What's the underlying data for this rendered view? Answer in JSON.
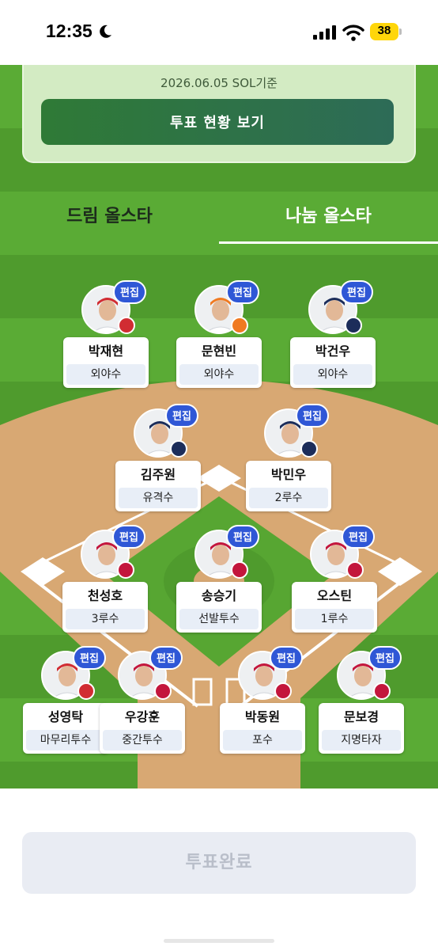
{
  "status_bar": {
    "time": "12:35",
    "battery": "38"
  },
  "info": {
    "date_text": "2026.06.05 SOL기준",
    "vote_status_button": "투표 현황 보기"
  },
  "tabs": [
    {
      "label": "드림 올스타",
      "active": false
    },
    {
      "label": "나눔 올스타",
      "active": true
    }
  ],
  "edit_label": "편집",
  "players": [
    {
      "name": "박재현",
      "position": "외야수",
      "team_color": "#d12c32"
    },
    {
      "name": "문현빈",
      "position": "외야수",
      "team_color": "#f07a21"
    },
    {
      "name": "박건우",
      "position": "외야수",
      "team_color": "#1c2d5a"
    },
    {
      "name": "김주원",
      "position": "유격수",
      "team_color": "#1c2d5a"
    },
    {
      "name": "박민우",
      "position": "2루수",
      "team_color": "#1c2d5a"
    },
    {
      "name": "천성호",
      "position": "3루수",
      "team_color": "#c3163c"
    },
    {
      "name": "송승기",
      "position": "선발투수",
      "team_color": "#c3163c"
    },
    {
      "name": "오스틴",
      "position": "1루수",
      "team_color": "#c3163c"
    },
    {
      "name": "성영탁",
      "position": "마무리투수",
      "team_color": "#d12c32"
    },
    {
      "name": "우강훈",
      "position": "중간투수",
      "team_color": "#c3163c"
    },
    {
      "name": "박동원",
      "position": "포수",
      "team_color": "#c3163c"
    },
    {
      "name": "문보경",
      "position": "지명타자",
      "team_color": "#c3163c"
    }
  ],
  "vote_complete_button": "투표완료",
  "colors": {
    "field_green": "#57a632",
    "infield_dirt": "#d8a873",
    "edit_blue": "#2f57d6",
    "vote_button": "#2f7a36"
  }
}
